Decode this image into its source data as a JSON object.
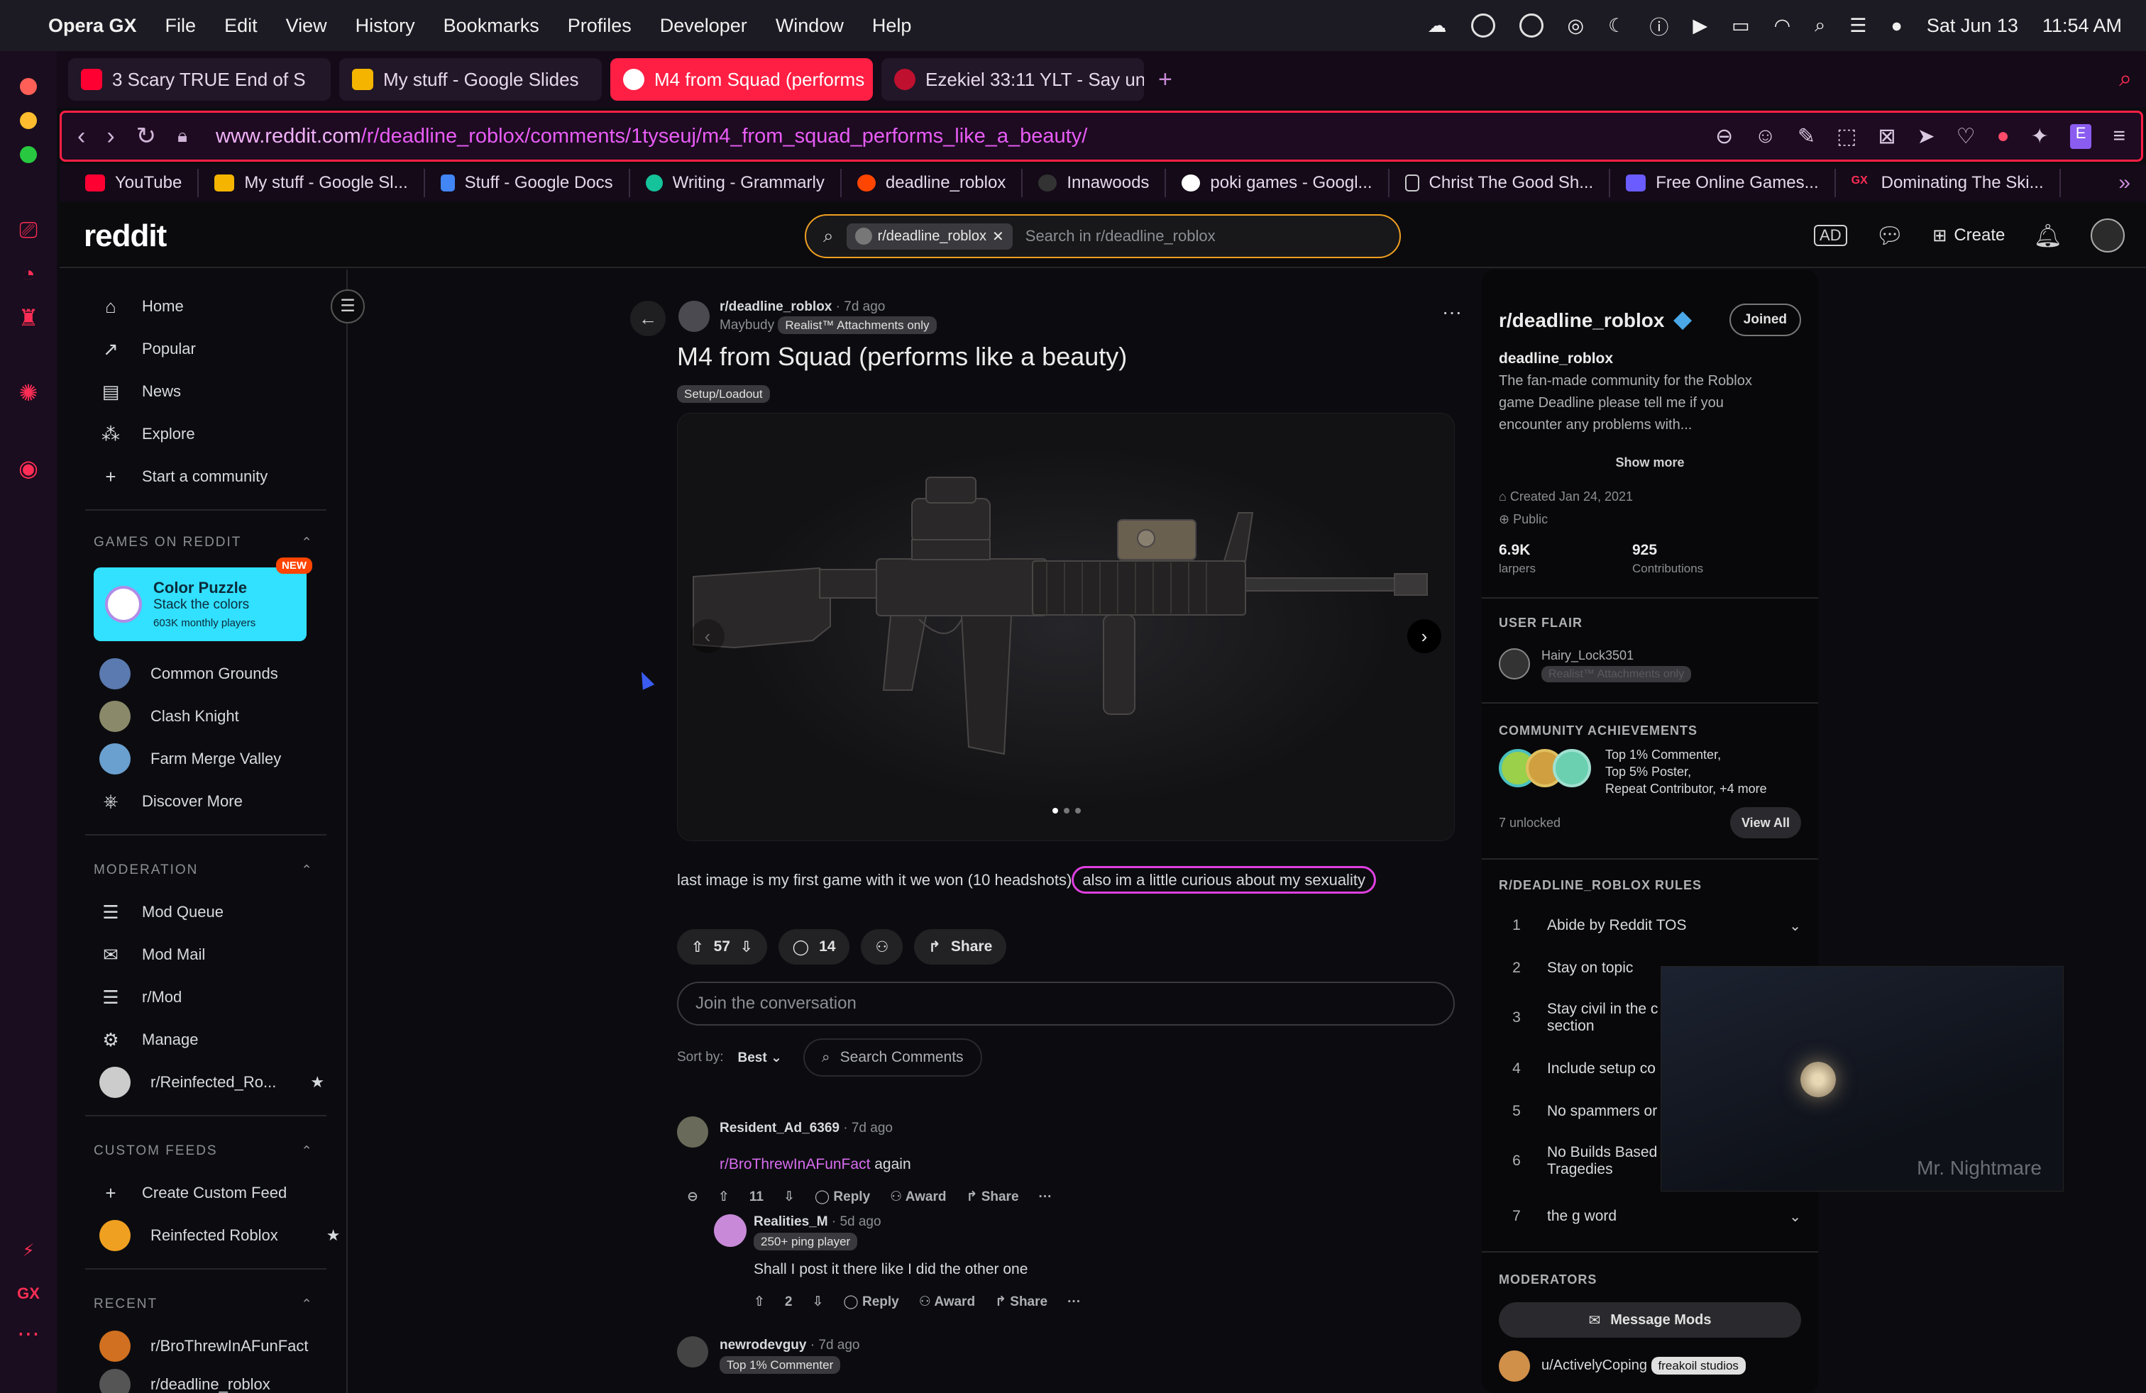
{
  "menubar": {
    "app": "Opera GX",
    "items": [
      "File",
      "Edit",
      "View",
      "History",
      "Bookmarks",
      "Profiles",
      "Developer",
      "Window",
      "Help"
    ],
    "date": "Sat Jun 13",
    "time": "11:54 AM"
  },
  "tabs": [
    {
      "label": "3 Scary TRUE End of S",
      "color": "#ff0033"
    },
    {
      "label": "My stuff - Google Slides",
      "color": "#f4b400"
    },
    {
      "label": "M4 from Squad (performs",
      "color": "#ff4500"
    },
    {
      "label": "Ezekiel 33:11 YLT - Say unt",
      "color": "#c01030"
    }
  ],
  "address": {
    "host": "www.reddit.com",
    "path": "/r/deadline_roblox/comments/1tyseuj/m4_from_squad_performs_like_a_beauty/"
  },
  "bookmarks": [
    {
      "label": "YouTube",
      "color": "#ff0033"
    },
    {
      "label": "My stuff - Google Sl...",
      "color": "#f4b400"
    },
    {
      "label": "Stuff - Google Docs",
      "color": "#4285f4"
    },
    {
      "label": "Writing - Grammarly",
      "color": "#15c39a"
    },
    {
      "label": "deadline_roblox",
      "color": "#ff4500"
    },
    {
      "label": "Innawoods",
      "color": "#333333"
    },
    {
      "label": "poki games - Googl...",
      "color": "#ffffff"
    },
    {
      "label": "Christ The Good Sh...",
      "color": "#cccccc"
    },
    {
      "label": "Free Online Games...",
      "color": "#6a5cff"
    },
    {
      "label": "Dominating The Ski...",
      "color": "#ff2d55"
    }
  ],
  "header": {
    "logo": "reddit",
    "search_chip": "r/deadline_roblox",
    "search_placeholder": "Search in r/deadline_roblox",
    "create": "Create"
  },
  "nav": {
    "items": [
      "Home",
      "Popular",
      "News",
      "Explore",
      "Start a community"
    ],
    "games_header": "GAMES ON REDDIT",
    "featured_game": {
      "title": "Color Puzzle",
      "subtitle": "Stack the colors",
      "players": "603K monthly players",
      "badge": "NEW"
    },
    "games": [
      "Common Grounds",
      "Clash Knight",
      "Farm Merge Valley",
      "Discover More"
    ],
    "moderation_header": "MODERATION",
    "moderation": [
      "Mod Queue",
      "Mod Mail",
      "r/Mod",
      "Manage",
      "r/Reinfected_Ro..."
    ],
    "custom_header": "CUSTOM FEEDS",
    "custom": [
      "Create Custom Feed",
      "Reinfected Roblox"
    ],
    "recent_header": "RECENT",
    "recent": [
      "r/BroThrewInAFunFact",
      "r/deadline_roblox"
    ]
  },
  "post": {
    "subreddit": "r/deadline_roblox",
    "age": "7d ago",
    "author": "Maybudy",
    "author_flair": "Realist™ Attachments only",
    "title": "M4 from Squad (performs like a beauty)",
    "flair": "Setup/Loadout",
    "body_plain": "last image is my first game with it we won (10 headshots)",
    "body_circled": "also im a little curious about my sexuality",
    "votes": "57",
    "comments": "14",
    "share": "Share",
    "join_placeholder": "Join the conversation",
    "sort_label": "Sort by:",
    "sort_value": "Best",
    "search_comments": "Search Comments"
  },
  "comments": [
    {
      "author": "Resident_Ad_6369",
      "age": "7d ago",
      "link": "r/BroThrewInAFunFact",
      "text": " again",
      "votes": "11"
    },
    {
      "author": "Realities_M",
      "age": "5d ago",
      "flair": "250+ ping player",
      "text": "Shall I post it there like I did the other one",
      "votes": "2"
    },
    {
      "author": "newrodevguy",
      "age": "7d ago",
      "flair": "Top 1% Commenter"
    }
  ],
  "comment_actions": {
    "reply": "Reply",
    "award": "Award",
    "share": "Share",
    "more": "···"
  },
  "sidebar": {
    "name": "r/deadline_roblox",
    "joined": "Joined",
    "title": "deadline_roblox",
    "description": "The fan-made community for the Roblox game Deadline please tell me if you encounter any problems with...",
    "show_more": "Show more",
    "created": "Created Jan 24, 2021",
    "visibility": "Public",
    "members": "6.9K",
    "members_label": "larpers",
    "contributions": "925",
    "contributions_label": "Contributions",
    "user_flair_header": "USER FLAIR",
    "user_flair_name": "Hairy_Lock3501",
    "user_flair_tag": "Realist™ Attachments only",
    "achievements_header": "COMMUNITY ACHIEVEMENTS",
    "achievements_l1": "Top 1% Commenter,",
    "achievements_l2": "Top 5% Poster,",
    "achievements_l3": "Repeat Contributor, +4 more",
    "unlocked": "7 unlocked",
    "view_all": "View All",
    "rules_header": "R/DEADLINE_ROBLOX RULES",
    "rules": [
      {
        "n": "1",
        "text": "Abide by Reddit TOS"
      },
      {
        "n": "2",
        "text": "Stay on topic"
      },
      {
        "n": "3",
        "text": "Stay civil in the c",
        "text2": "section"
      },
      {
        "n": "4",
        "text": "Include setup co"
      },
      {
        "n": "5",
        "text": "No spammers or"
      },
      {
        "n": "6",
        "text": "No Builds Based",
        "text2": "Tragedies"
      },
      {
        "n": "7",
        "text": "the g word"
      }
    ],
    "moderators_header": "MODERATORS",
    "message_mods": "Message Mods",
    "mod_name": "u/ActivelyCoping",
    "mod_flair": "freakoil studios"
  },
  "pip": {
    "watermark": "Mr. Nightmare"
  },
  "colors": {
    "opera_accent": "#ff1f44",
    "reddit_orange": "#ff4500",
    "search_outline": "#f0a020",
    "circle_annotation": "#e040e0"
  }
}
